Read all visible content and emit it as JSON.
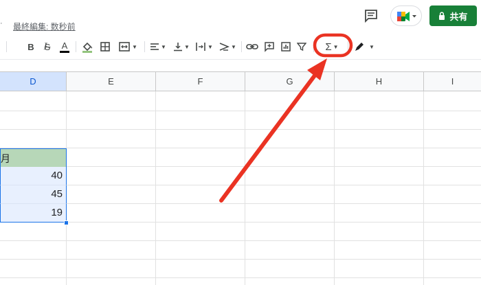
{
  "header": {
    "menu_fragment": "·",
    "last_edit": "最終編集: 数秒前",
    "share_label": "共有"
  },
  "toolbar": {
    "items": [
      "bold-button",
      "italic-button",
      "strikethrough-button",
      "text-color-button",
      "fill-color-button",
      "borders-button",
      "merge-cells-button",
      "horizontal-align-button",
      "vertical-align-button",
      "text-wrap-button",
      "text-rotation-button",
      "insert-link-button",
      "insert-comment-button",
      "insert-chart-button",
      "filter-button",
      "functions-button",
      "pen-button"
    ],
    "bold": "B",
    "italic": "I",
    "strike": "S",
    "textcolor": "A",
    "functions": "Σ"
  },
  "columns": [
    "D",
    "E",
    "F",
    "G",
    "H",
    "I"
  ],
  "cells": {
    "header_fragment": "月",
    "values": [
      "40",
      "45",
      "19"
    ]
  },
  "colors": {
    "accent_green": "#188038",
    "header_fill": "#b7d7b8",
    "selection_fill": "#e8f0fe",
    "selection_border": "#1a73e8",
    "highlight_red": "#ea3323"
  }
}
